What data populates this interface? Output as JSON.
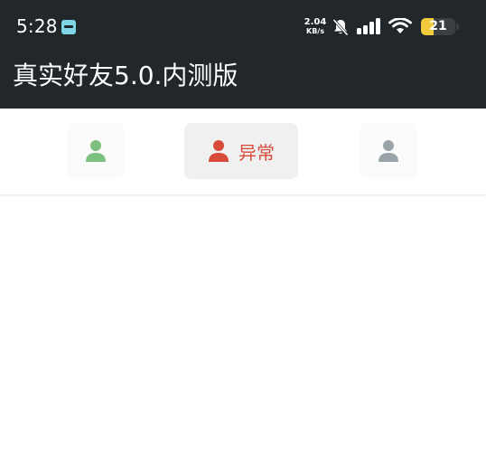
{
  "status_bar": {
    "time": "5:28",
    "network_speed_value": "2.04",
    "network_speed_unit": "KB/s",
    "battery_level": "21",
    "battery_fraction": 0.21,
    "icons": [
      "app-notification-icon",
      "bell-muted-icon",
      "signal-icon",
      "wifi-icon",
      "battery-icon"
    ]
  },
  "app_bar": {
    "title": "真实好友5.0.内测版"
  },
  "tabs": [
    {
      "label": "",
      "icon": "person-icon",
      "color": "#7cbf7e",
      "selected": false
    },
    {
      "label": "异常",
      "icon": "person-icon",
      "color": "#d84a3a",
      "selected": true
    },
    {
      "label": "",
      "icon": "person-icon",
      "color": "#9aa3a8",
      "selected": false
    }
  ],
  "colors": {
    "header_bg": "#22272b",
    "selected_tab_bg": "#f0f0f0",
    "battery_fill": "#f2cc3e"
  }
}
